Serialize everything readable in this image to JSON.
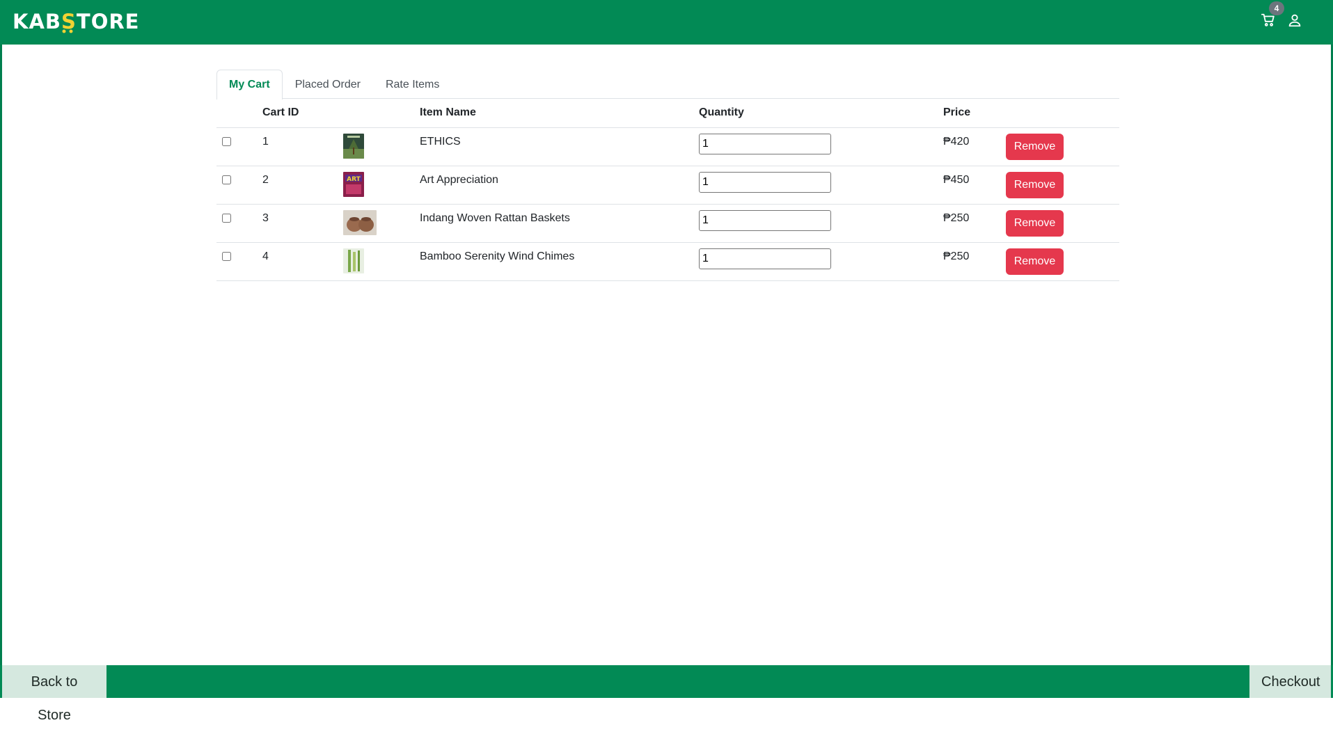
{
  "brand": {
    "name_part1": "KAB",
    "name_accent": "S",
    "name_part2": "TORE",
    "primary_color": "#028a55",
    "accent_color": "#f2d233"
  },
  "header": {
    "cart_icon": "cart-icon",
    "cart_count": "4",
    "user_icon": "user-icon"
  },
  "tabs": [
    {
      "label": "My Cart",
      "active": true
    },
    {
      "label": "Placed Order",
      "active": false
    },
    {
      "label": "Rate Items",
      "active": false
    }
  ],
  "table": {
    "headers": {
      "cart_id": "Cart ID",
      "item_name": "Item Name",
      "quantity": "Quantity",
      "price": "Price"
    },
    "rows": [
      {
        "cart_id": "1",
        "item_name": "ETHICS",
        "quantity": "1",
        "price": "₱420",
        "thumb": "ethics-book-thumbnail",
        "remove": "Remove"
      },
      {
        "cart_id": "2",
        "item_name": "Art Appreciation",
        "quantity": "1",
        "price": "₱450",
        "thumb": "art-book-thumbnail",
        "remove": "Remove"
      },
      {
        "cart_id": "3",
        "item_name": "Indang Woven Rattan Baskets",
        "quantity": "1",
        "price": "₱250",
        "thumb": "rattan-baskets-thumbnail",
        "remove": "Remove"
      },
      {
        "cart_id": "4",
        "item_name": "Bamboo Serenity Wind Chimes",
        "quantity": "1",
        "price": "₱250",
        "thumb": "wind-chimes-thumbnail",
        "remove": "Remove"
      }
    ]
  },
  "footer": {
    "back_label": "Back to Store",
    "checkout_label": "Checkout"
  }
}
